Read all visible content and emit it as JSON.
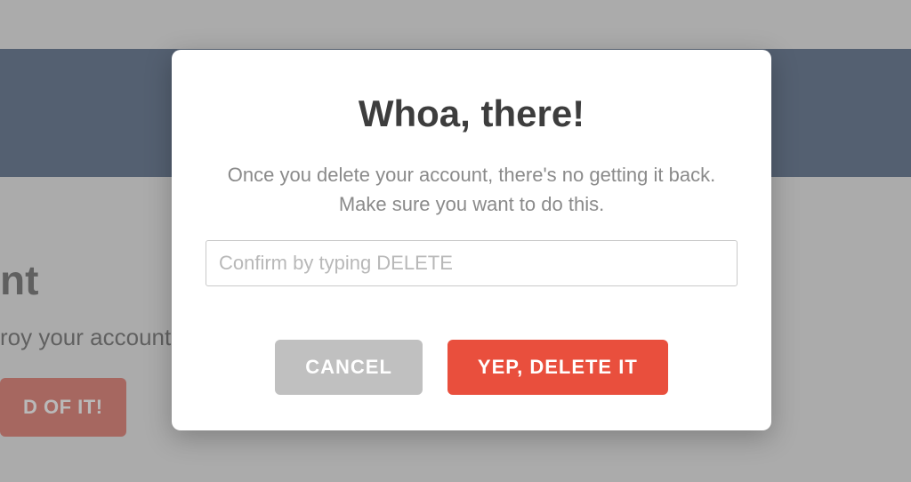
{
  "background": {
    "heading_fragment": "nt",
    "text_fragment": "roy your account.",
    "button_fragment": "D OF IT!"
  },
  "modal": {
    "title": "Whoa, there!",
    "message": "Once you delete your account, there's no getting it back. Make sure you want to do this.",
    "confirm_input": {
      "placeholder": "Confirm by typing DELETE",
      "value": ""
    },
    "cancel_label": "CANCEL",
    "confirm_label": "YEP, DELETE IT"
  },
  "colors": {
    "nav_band": "#1f3a5f",
    "danger": "#e94f3d",
    "cancel": "#c0c0c0"
  }
}
